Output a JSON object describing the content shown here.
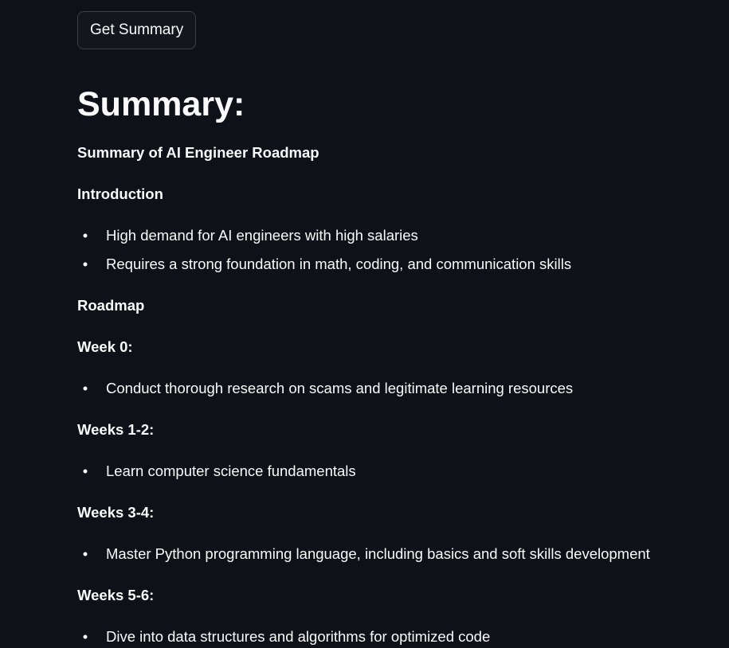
{
  "button": {
    "label": "Get Summary"
  },
  "heading": "Summary:",
  "summary": {
    "title": "Summary of AI Engineer Roadmap",
    "introduction": {
      "label": "Introduction",
      "items": [
        "High demand for AI engineers with high salaries",
        "Requires a strong foundation in math, coding, and communication skills"
      ]
    },
    "roadmap_label": "Roadmap",
    "weeks": [
      {
        "label": "Week 0:",
        "items": [
          "Conduct thorough research on scams and legitimate learning resources"
        ]
      },
      {
        "label": "Weeks 1-2:",
        "items": [
          "Learn computer science fundamentals"
        ]
      },
      {
        "label": "Weeks 3-4:",
        "items": [
          "Master Python programming language, including basics and soft skills development"
        ]
      },
      {
        "label": "Weeks 5-6:",
        "items": [
          "Dive into data structures and algorithms for optimized code"
        ]
      }
    ]
  },
  "colors": {
    "background": "#0e1117",
    "text": "#fafafa",
    "button_border": "#3c4049"
  }
}
